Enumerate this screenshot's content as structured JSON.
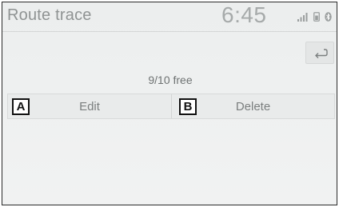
{
  "header": {
    "title": "Route trace",
    "time": "6:45",
    "status_icons": [
      "signal-bars-icon",
      "phone-battery-icon",
      "bluetooth-icon"
    ]
  },
  "back_button": {
    "icon": "back-arrow-icon"
  },
  "memory": {
    "free_label": "9/10 free"
  },
  "actions": [
    {
      "callout": "A",
      "label": "Edit"
    },
    {
      "callout": "B",
      "label": "Delete"
    }
  ],
  "colors": {
    "background": "#eef0f0",
    "text_muted": "#8f9393",
    "frame_border": "#2a2a2a"
  }
}
